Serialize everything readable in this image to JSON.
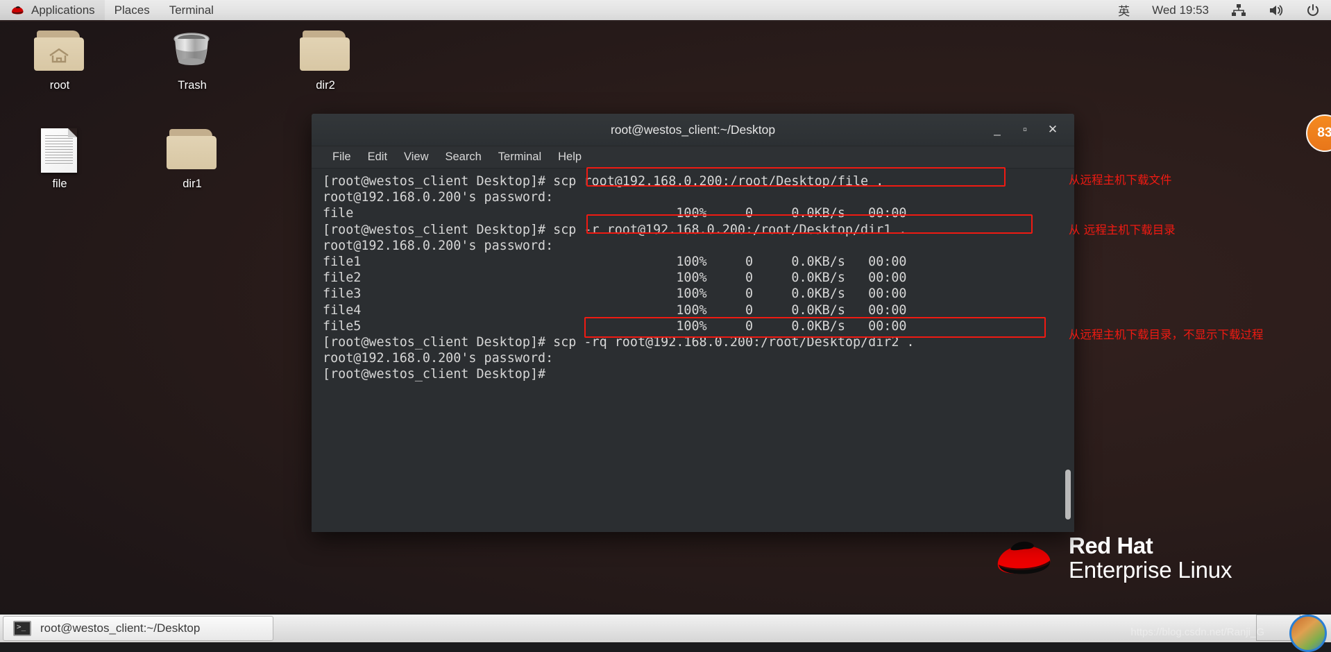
{
  "top_panel": {
    "applications": "Applications",
    "places": "Places",
    "terminal": "Terminal",
    "input_method": "英",
    "clock": "Wed 19:53",
    "icons": {
      "network": "network-icon",
      "volume": "volume-icon",
      "power": "power-icon",
      "logo": "redhat-logo-icon"
    }
  },
  "desktop_icons": [
    {
      "label": "root",
      "type": "home-folder"
    },
    {
      "label": "Trash",
      "type": "trash"
    },
    {
      "label": "dir2",
      "type": "folder"
    },
    {
      "label": "file",
      "type": "document"
    },
    {
      "label": "dir1",
      "type": "folder"
    }
  ],
  "terminal": {
    "title": "root@westos_client:~/Desktop",
    "menu": [
      "File",
      "Edit",
      "View",
      "Search",
      "Terminal",
      "Help"
    ],
    "window_buttons": {
      "minimize": "_",
      "maximize": "▫",
      "close": "✕"
    },
    "prompt": "[root@westos_client Desktop]# ",
    "lines": [
      {
        "prompt": "[root@westos_client Desktop]# ",
        "cmd": "scp root@192.168.0.200:/root/Desktop/file . ",
        "boxed": true
      },
      {
        "text": "root@192.168.0.200's password:"
      },
      {
        "file": "file",
        "pct": "100%",
        "bytes": "0",
        "rate": "0.0KB/s",
        "eta": "00:00"
      },
      {
        "prompt": "[root@westos_client Desktop]# ",
        "cmd": "scp -r root@192.168.0.200:/root/Desktop/dir1 . ",
        "boxed": true
      },
      {
        "text": "root@192.168.0.200's password:"
      },
      {
        "file": "file1",
        "pct": "100%",
        "bytes": "0",
        "rate": "0.0KB/s",
        "eta": "00:00"
      },
      {
        "file": "file2",
        "pct": "100%",
        "bytes": "0",
        "rate": "0.0KB/s",
        "eta": "00:00"
      },
      {
        "file": "file3",
        "pct": "100%",
        "bytes": "0",
        "rate": "0.0KB/s",
        "eta": "00:00"
      },
      {
        "file": "file4",
        "pct": "100%",
        "bytes": "0",
        "rate": "0.0KB/s",
        "eta": "00:00"
      },
      {
        "file": "file5",
        "pct": "100%",
        "bytes": "0",
        "rate": "0.0KB/s",
        "eta": "00:00"
      },
      {
        "prompt": "[root@westos_client Desktop]# ",
        "cmd": "scp -rq root@192.168.0.200:/root/Desktop/dir2 . ",
        "boxed": true
      },
      {
        "text": "root@192.168.0.200's password:"
      },
      {
        "text": "[root@westos_client Desktop]#"
      }
    ],
    "screen_text": "[root@westos_client Desktop]# scp root@192.168.0.200:/root/Desktop/file .\nroot@192.168.0.200's password:\nfile                                          100%     0     0.0KB/s   00:00\n[root@westos_client Desktop]# scp -r root@192.168.0.200:/root/Desktop/dir1 .\nroot@192.168.0.200's password:\nfile1                                         100%     0     0.0KB/s   00:00\nfile2                                         100%     0     0.0KB/s   00:00\nfile3                                         100%     0     0.0KB/s   00:00\nfile4                                         100%     0     0.0KB/s   00:00\nfile5                                         100%     0     0.0KB/s   00:00\n[root@westos_client Desktop]# scp -rq root@192.168.0.200:/root/Desktop/dir2 .\nroot@192.168.0.200's password:\n[root@westos_client Desktop]#"
  },
  "annotations": [
    {
      "text": "从远程主机下载文件"
    },
    {
      "text": "从 远程主机下载目录"
    },
    {
      "text": "从远程主机下载目录，不显示下载过程"
    }
  ],
  "branding": {
    "line1": "Red Hat",
    "line2": "Enterprise Linux"
  },
  "side_badge": {
    "value": "83"
  },
  "taskbar": {
    "window_title": "root@westos_client:~/Desktop"
  },
  "watermark": {
    "text": "https://blog.csdn.net/Ranji_G"
  },
  "colors": {
    "accent_red": "#f01a12",
    "terminal_bg": "#2b2e31",
    "panel_bg": "#e6e6e6",
    "badge_orange": "#ef7f1f"
  }
}
